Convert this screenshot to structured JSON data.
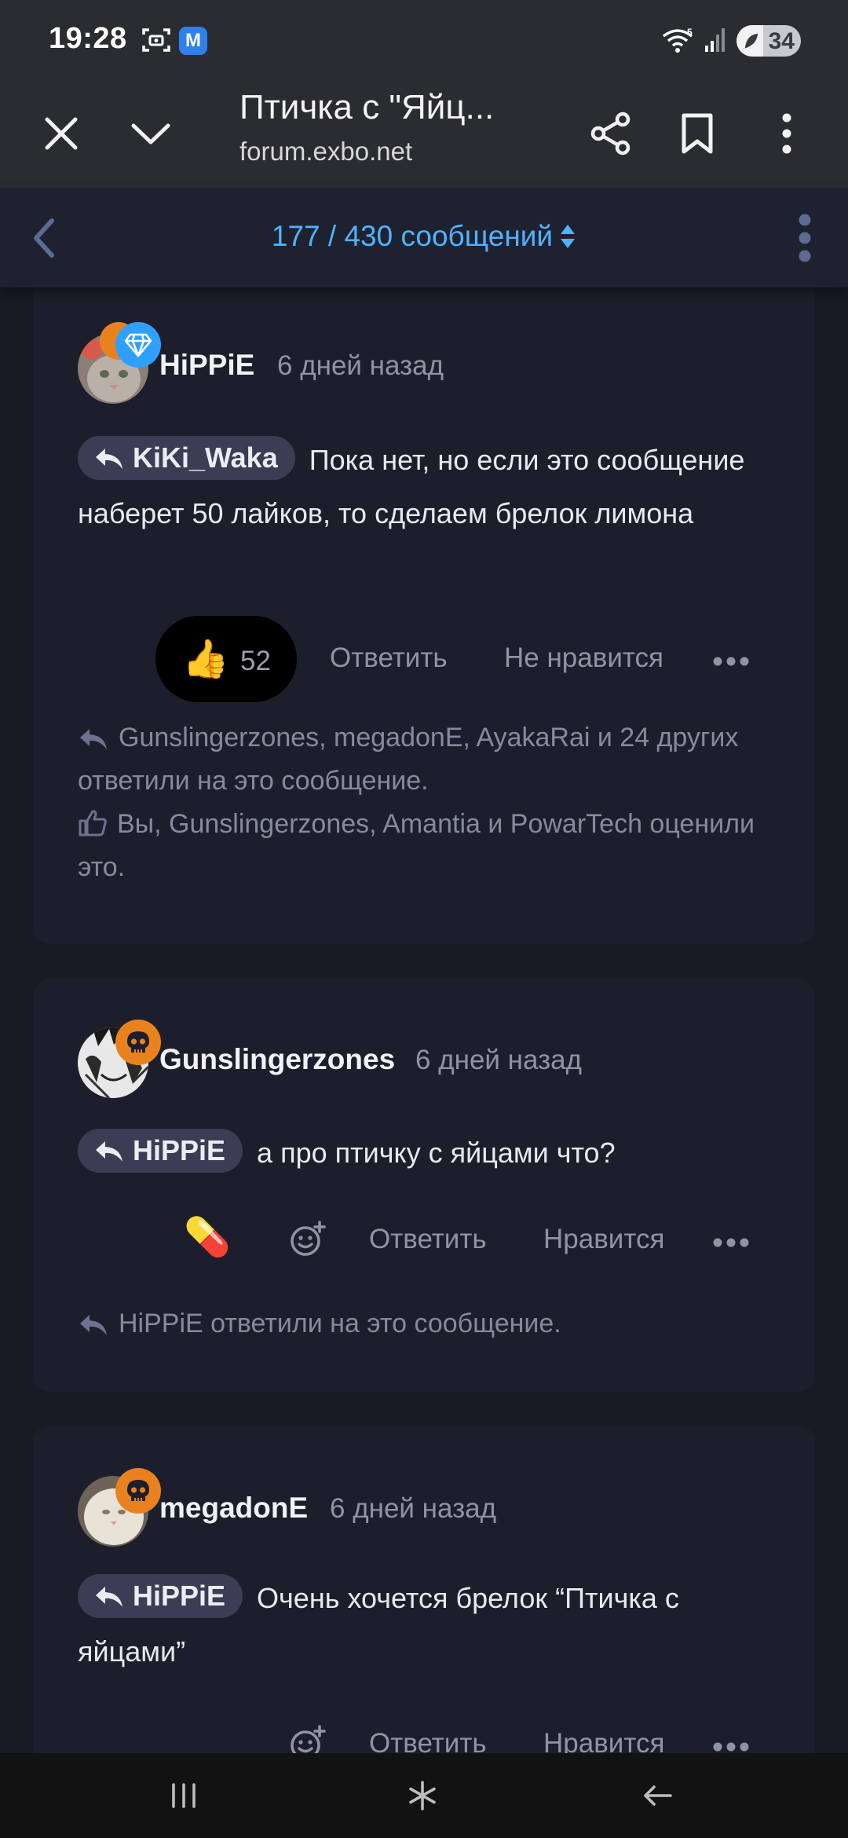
{
  "status_bar": {
    "time": "19:28",
    "battery": "34",
    "icons": [
      "screenshot-icon",
      "app-m-icon",
      "wifi-icon",
      "signal-icon",
      "battery-icon"
    ],
    "app_icon_letter": "M"
  },
  "browser": {
    "title": "Птичка с \"Яйц...",
    "url": "forum.exbo.net",
    "icons": [
      "close-icon",
      "chevron-down-icon",
      "share-icon",
      "bookmark-icon",
      "more-vertical-icon"
    ]
  },
  "forum_nav": {
    "counter": "177 / 430 сообщений",
    "icons": [
      "back-icon",
      "sort-icon",
      "more-vertical-icon"
    ],
    "accent": "#4fb3ff"
  },
  "posts": [
    {
      "author": "HiPPiE",
      "time": "6 дней назад",
      "badge": "diamond-badge-icon",
      "badge_color": "#2fa0ff",
      "reply_to": "KiKi_Waka",
      "text": "Пока нет, но если это сообщение наберет 50 лайков, то сделаем брелок лимона",
      "reaction_emoji": "👍",
      "reaction_count": "52",
      "reply_label": "Ответить",
      "like_label": "Не нравится",
      "replies_summary": "Gunslingerzones, megadonE, AyakaRai и 24 других ответили на это сообщение.",
      "likes_summary": "Вы, Gunslingerzones, Amantia и PowarTech оценили это."
    },
    {
      "author": "Gunslingerzones",
      "time": "6 дней назад",
      "badge": "skull-badge-icon",
      "badge_color": "#e9821e",
      "reply_to": "HiPPiE",
      "text": "а про птичку с яйцами что?",
      "reaction_emoji": "💊",
      "reply_label": "Ответить",
      "like_label": "Нравится",
      "replies_summary": "HiPPiE ответили на это сообщение."
    },
    {
      "author": "megadonE",
      "time": "6 дней назад",
      "badge": "skull-badge-icon",
      "badge_color": "#e9821e",
      "reply_to": "HiPPiE",
      "text": "Очень хочется брелок “Птичка с яйцами”",
      "reply_label": "Ответить",
      "like_label": "Нравится"
    }
  ],
  "nav_bar": {
    "icons": [
      "recent-apps-icon",
      "home-icon",
      "back-arrow-icon"
    ]
  }
}
